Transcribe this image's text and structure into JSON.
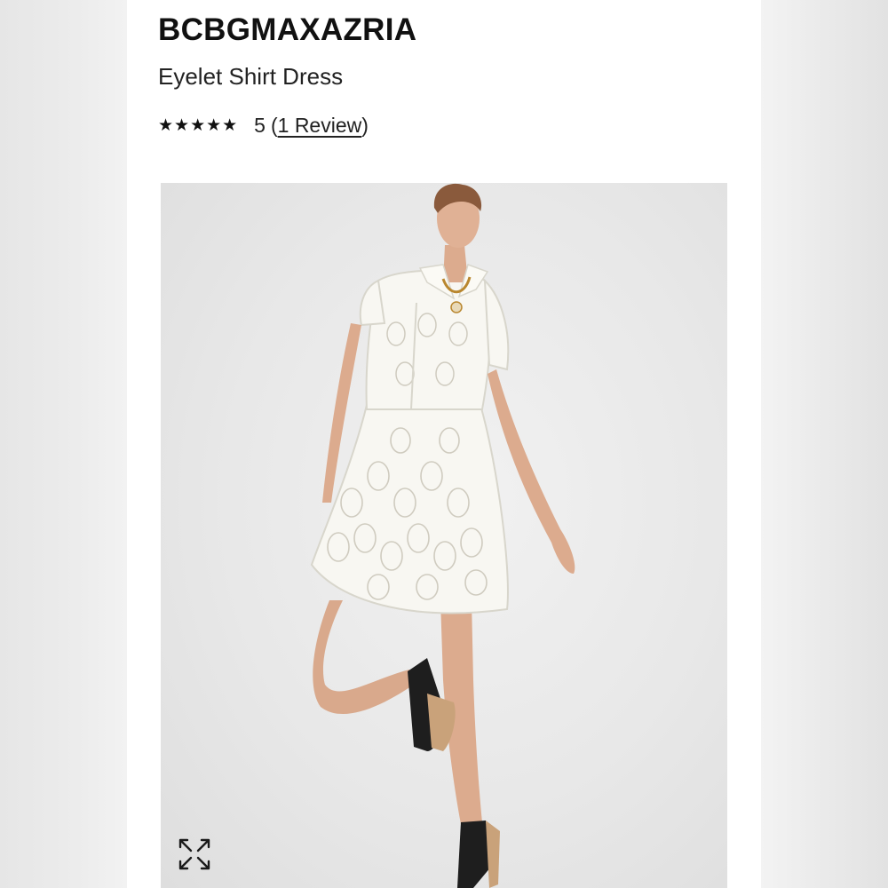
{
  "product": {
    "brand": "BCBGMAXAZRIA",
    "name": "Eyelet Shirt Dress",
    "rating": {
      "stars_glyphs": "★★★★★",
      "stars_value": 5,
      "value_text": "5",
      "open_paren": "(",
      "review_link": "1 Review",
      "close_paren": ")"
    }
  },
  "image": {
    "subject": "model-in-white-eyelet-shirt-dress",
    "expand_icon": "expand-arrows-icon"
  }
}
